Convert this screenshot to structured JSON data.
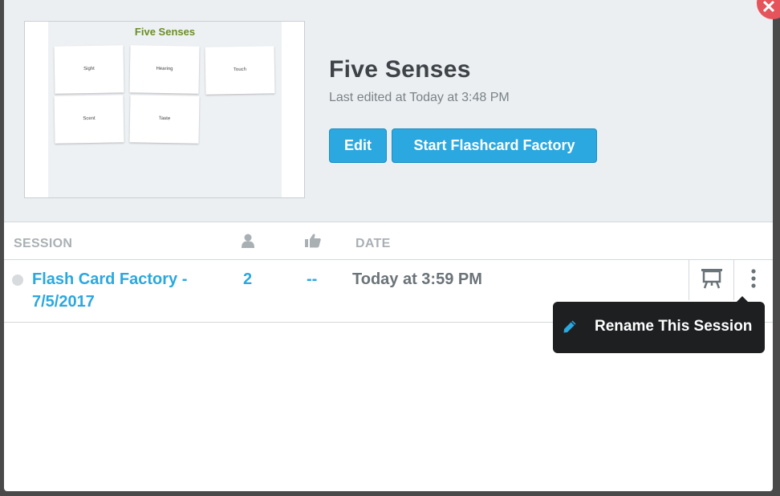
{
  "header": {
    "title": "Five Senses",
    "subtitle": "Last edited at Today at 3:48 PM",
    "edit_label": "Edit",
    "start_label": "Start Flashcard Factory",
    "close_icon": "close-icon"
  },
  "thumbnail": {
    "title": "Five Senses",
    "cards": [
      "Sight",
      "Hearing",
      "Touch",
      "Scent",
      "Taste"
    ]
  },
  "table": {
    "headers": {
      "session": "SESSION",
      "participants_icon": "person-icon",
      "likes_icon": "thumbs-up-icon",
      "date": "DATE"
    },
    "rows": [
      {
        "name": "Flash Card Factory - 7/5/2017",
        "participants": "2",
        "likes": "--",
        "date": "Today at 3:59 PM"
      }
    ]
  },
  "tooltip": {
    "label": "Rename This Session",
    "icon": "pencil-icon"
  },
  "colors": {
    "accent": "#2aa8df",
    "close": "#e5545a",
    "header_bg": "#eceff2",
    "tooltip_bg": "#1d1f21",
    "thumb_title": "#6b8e23"
  }
}
